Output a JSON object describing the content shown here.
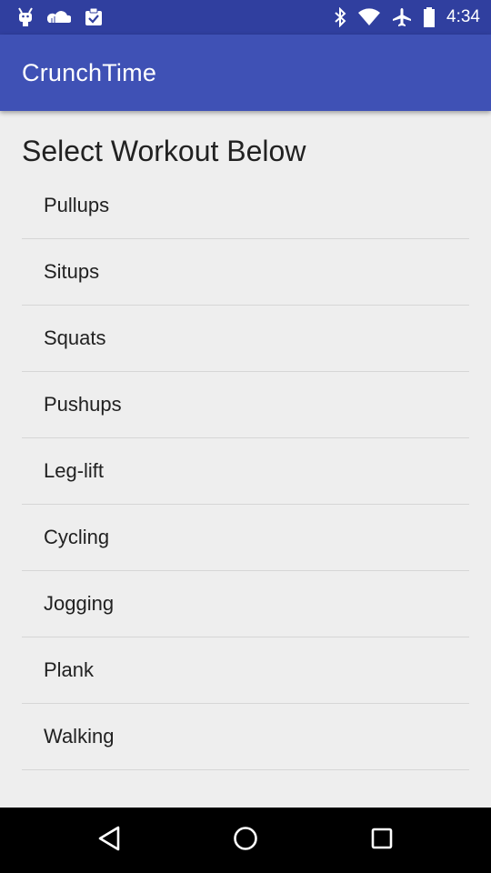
{
  "status_bar": {
    "time": "4:34",
    "left_icons": [
      "android-debug-icon",
      "cloud-icon",
      "clipboard-check-icon"
    ],
    "right_icons": [
      "bluetooth-icon",
      "wifi-icon",
      "airplane-mode-icon",
      "battery-icon"
    ],
    "color": "#303f9f"
  },
  "app_bar": {
    "title": "CrunchTime",
    "color": "#3f51b5"
  },
  "main": {
    "section_title": "Select Workout Below",
    "workouts": [
      {
        "label": "Pullups"
      },
      {
        "label": "Situps"
      },
      {
        "label": "Squats"
      },
      {
        "label": "Pushups"
      },
      {
        "label": "Leg-lift"
      },
      {
        "label": "Cycling"
      },
      {
        "label": "Jogging"
      },
      {
        "label": "Plank"
      },
      {
        "label": "Walking"
      }
    ]
  },
  "nav_bar": {
    "buttons": [
      "back-icon",
      "home-icon",
      "recents-icon"
    ]
  }
}
